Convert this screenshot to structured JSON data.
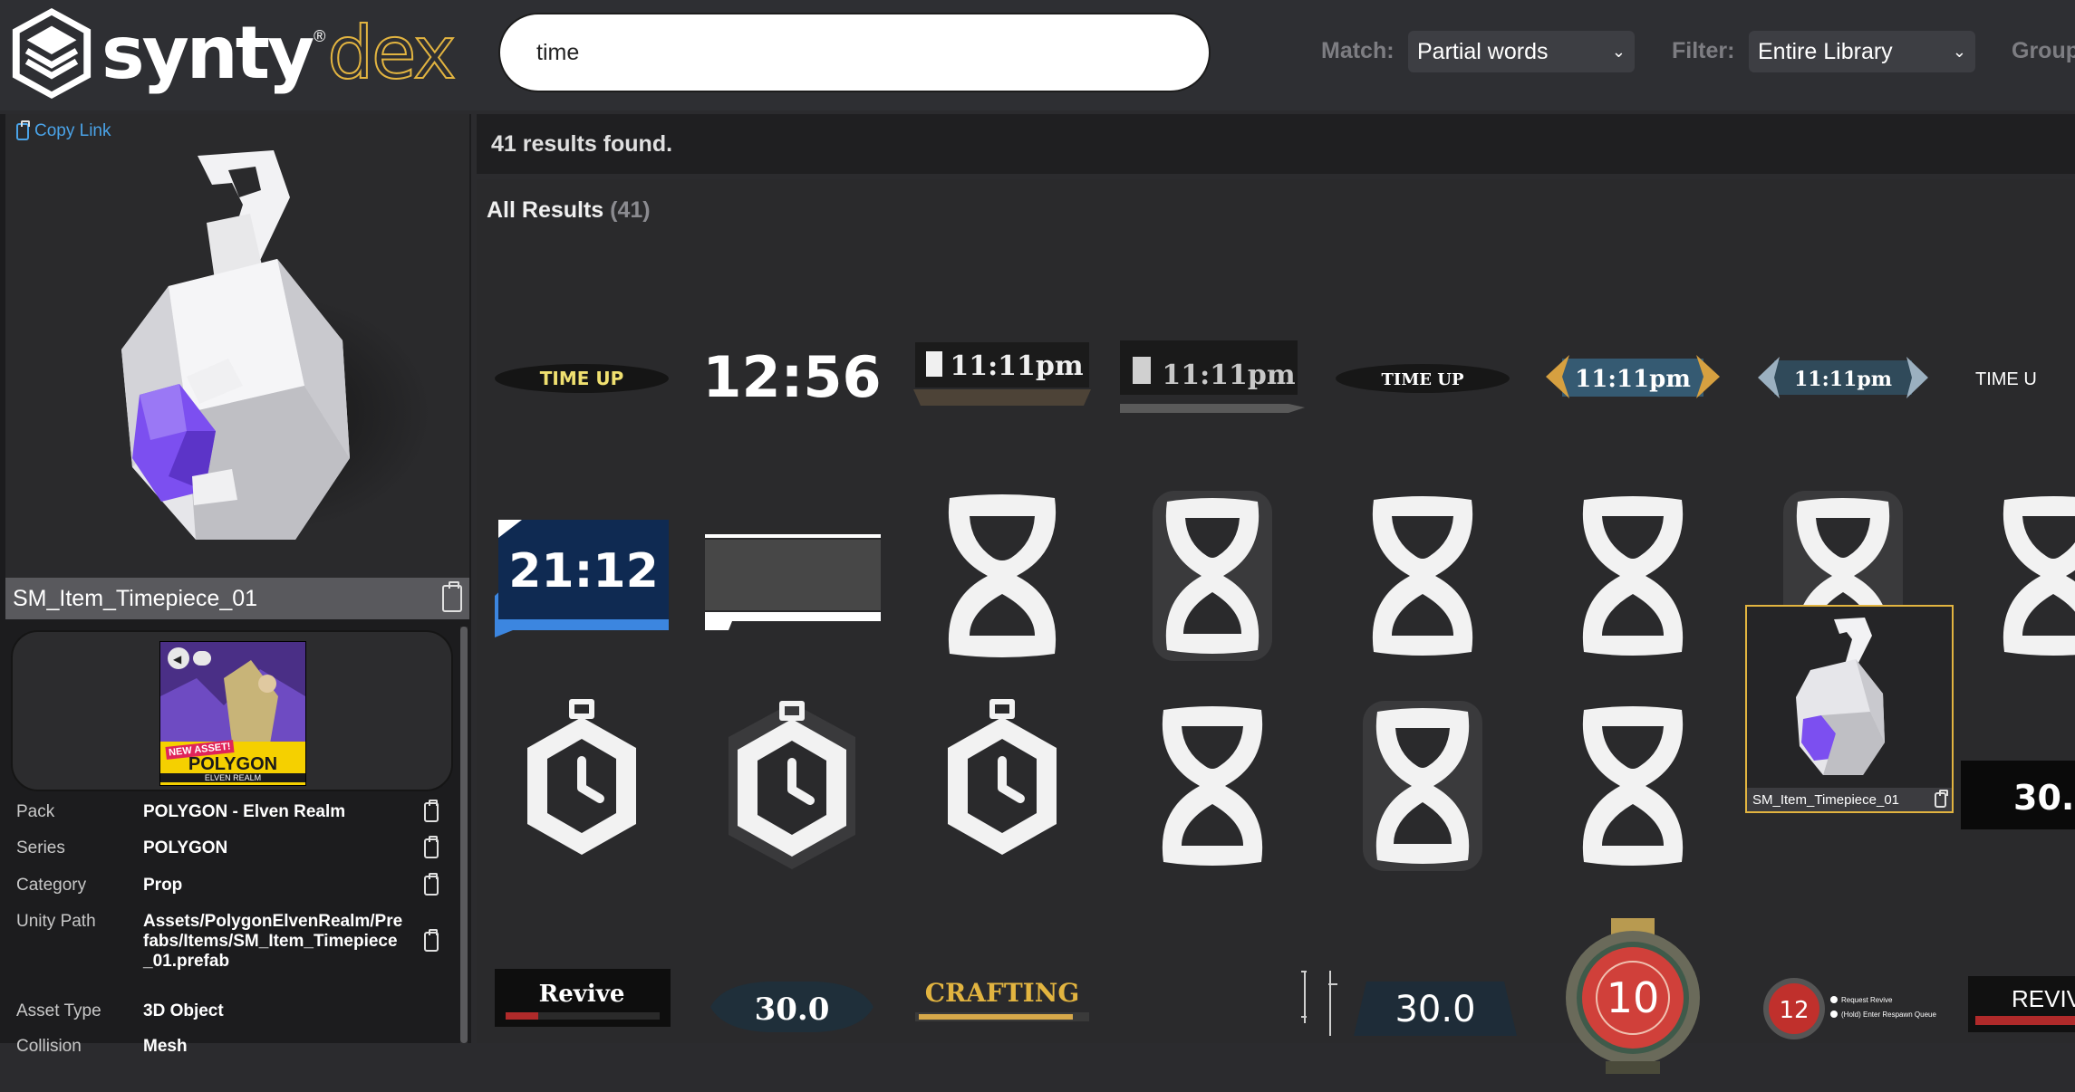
{
  "app": {
    "logo_word": "synty",
    "logo_reg": "®",
    "logo_accent": "dex",
    "accent_color": "#e2b440"
  },
  "search": {
    "value": "time",
    "placeholder": ""
  },
  "match": {
    "label": "Match:",
    "value": "Partial words"
  },
  "filter": {
    "label": "Filter:",
    "value": "Entire Library"
  },
  "group": {
    "label": "Group"
  },
  "left": {
    "copy_link": "Copy Link",
    "asset_name": "SM_Item_Timepiece_01",
    "pack_thumb": {
      "badge": "NEW ASSET!",
      "title": "POLYGON",
      "subtitle": "ELVEN REALM"
    },
    "properties": [
      {
        "key": "Pack",
        "value": "POLYGON - Elven Realm"
      },
      {
        "key": "Series",
        "value": "POLYGON"
      },
      {
        "key": "Category",
        "value": "Prop"
      },
      {
        "key": "Unity Path",
        "value": "Assets/PolygonElvenRealm/Prefabs/Items/SM_Item_Timepiece_01.prefab"
      },
      {
        "key": "Asset Type",
        "value": "3D Object"
      },
      {
        "key": "Collision",
        "value": "Mesh"
      }
    ]
  },
  "results": {
    "summary": "41 results found.",
    "section_title": "All Results",
    "section_count": "(41)",
    "selected_caption": "SM_Item_Timepiece_01",
    "tile_texts": {
      "time_up": "TIME UP",
      "clock_1256": "12:56",
      "time_1111": "11:11pm",
      "time_2112": "21:12",
      "time_up_partial": "TIME U",
      "thirty_partial": "30.",
      "revive": "Revive",
      "thirty": "30.0",
      "crafting": "CRAFTING",
      "ten": "10",
      "twelve": "12",
      "request_revive": "Request Revive",
      "respawn_queue": "(Hold) Enter Respawn Queue",
      "revive_partial": "REVIV"
    }
  }
}
